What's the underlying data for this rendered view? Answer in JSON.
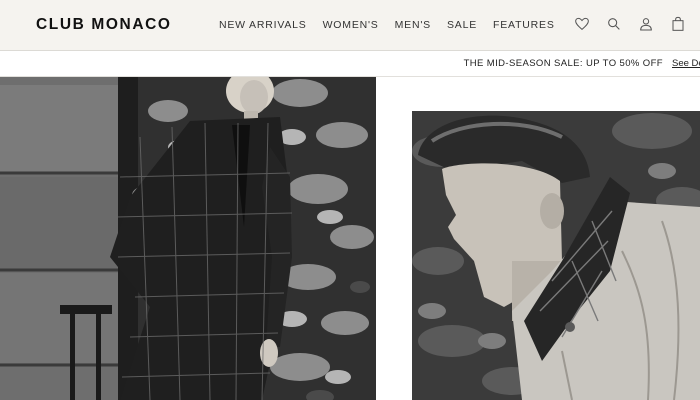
{
  "brand": {
    "logo_text": "CLUB MONACO"
  },
  "nav": {
    "items": [
      {
        "label": "NEW ARRIVALS",
        "name": "nav-new-arrivals"
      },
      {
        "label": "WOMEN'S",
        "name": "nav-womens"
      },
      {
        "label": "MEN'S",
        "name": "nav-mens"
      },
      {
        "label": "SALE",
        "name": "nav-sale"
      },
      {
        "label": "FEATURES",
        "name": "nav-features"
      }
    ]
  },
  "header_icons": [
    "heart-icon",
    "search-icon",
    "account-icon",
    "shopping-bag-icon"
  ],
  "promo": {
    "text": "THE MID-SEASON SALE: UP TO 50% OFF",
    "link_label": "See De"
  },
  "colors": {
    "header_bg": "#f5f3ef",
    "text": "#111111",
    "photo_dark": "#2c2c2c"
  }
}
